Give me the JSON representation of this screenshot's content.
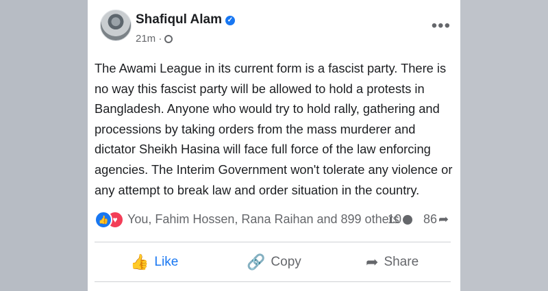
{
  "post": {
    "author": "Shafiqul Alam",
    "time": "21m",
    "more_label": "•••",
    "text": "The Awami League in its current form is a fascist party. There is no way this fascist party will be allowed to hold a protests in Bangladesh. Anyone who would try to hold rally, gathering and processions by taking orders from the mass murderer and dictator Sheikh Hasina will face full force of the law enforcing agencies. The Interim Government won't tolerate any violence or any attempt to break law and order situation in the country."
  },
  "reactions": {
    "names": "You, Fahim Hossen, Rana Raihan and 899 others",
    "comments": "10",
    "shares": "86"
  },
  "actions": {
    "like": "Like",
    "copy": "Copy",
    "share": "Share"
  },
  "colors": {
    "accent": "#1877f2",
    "love": "#f33e58",
    "muted_text": "#65676b",
    "text": "#1c1e21"
  },
  "icons": {
    "verified": "verified-badge-icon",
    "privacy": "globe-icon",
    "like": "thumbs-up-icon",
    "copy": "link-icon",
    "share": "share-arrow-icon",
    "comment": "comment-bubble-icon"
  }
}
